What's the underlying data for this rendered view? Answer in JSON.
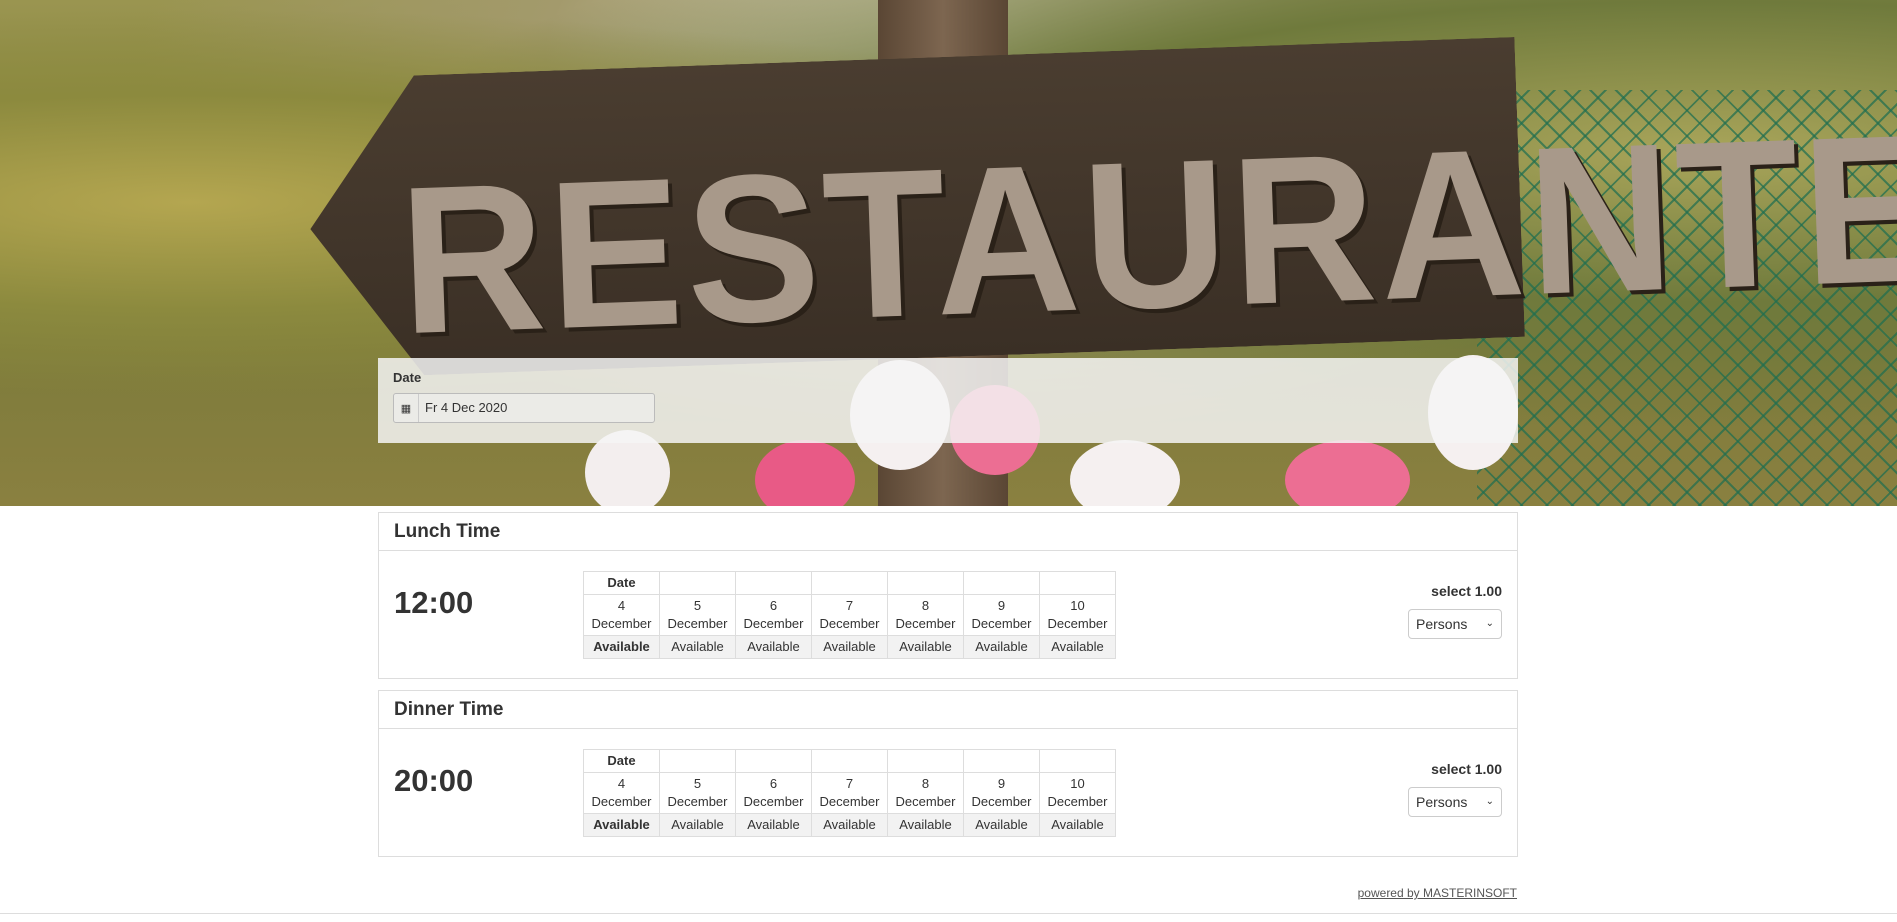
{
  "hero": {
    "sign_text": "RESTAURANTE"
  },
  "date_filter": {
    "label": "Date",
    "value": "Fr 4 Dec 2020",
    "icon": "calendar-icon"
  },
  "sections": [
    {
      "title": "Lunch Time",
      "time": "12:00",
      "table_header": "Date",
      "days": [
        {
          "day": "4",
          "month": "December",
          "status": "Available"
        },
        {
          "day": "5",
          "month": "December",
          "status": "Available"
        },
        {
          "day": "6",
          "month": "December",
          "status": "Available"
        },
        {
          "day": "7",
          "month": "December",
          "status": "Available"
        },
        {
          "day": "8",
          "month": "December",
          "status": "Available"
        },
        {
          "day": "9",
          "month": "December",
          "status": "Available"
        },
        {
          "day": "10",
          "month": "December",
          "status": "Available"
        }
      ],
      "select_label": "select 1.00",
      "select_value": "Persons"
    },
    {
      "title": "Dinner Time",
      "time": "20:00",
      "table_header": "Date",
      "days": [
        {
          "day": "4",
          "month": "December",
          "status": "Available"
        },
        {
          "day": "5",
          "month": "December",
          "status": "Available"
        },
        {
          "day": "6",
          "month": "December",
          "status": "Available"
        },
        {
          "day": "7",
          "month": "December",
          "status": "Available"
        },
        {
          "day": "8",
          "month": "December",
          "status": "Available"
        },
        {
          "day": "9",
          "month": "December",
          "status": "Available"
        },
        {
          "day": "10",
          "month": "December",
          "status": "Available"
        }
      ],
      "select_label": "select 1.00",
      "select_value": "Persons"
    }
  ],
  "footer": {
    "powered_by": "powered by MASTERINSOFT"
  }
}
